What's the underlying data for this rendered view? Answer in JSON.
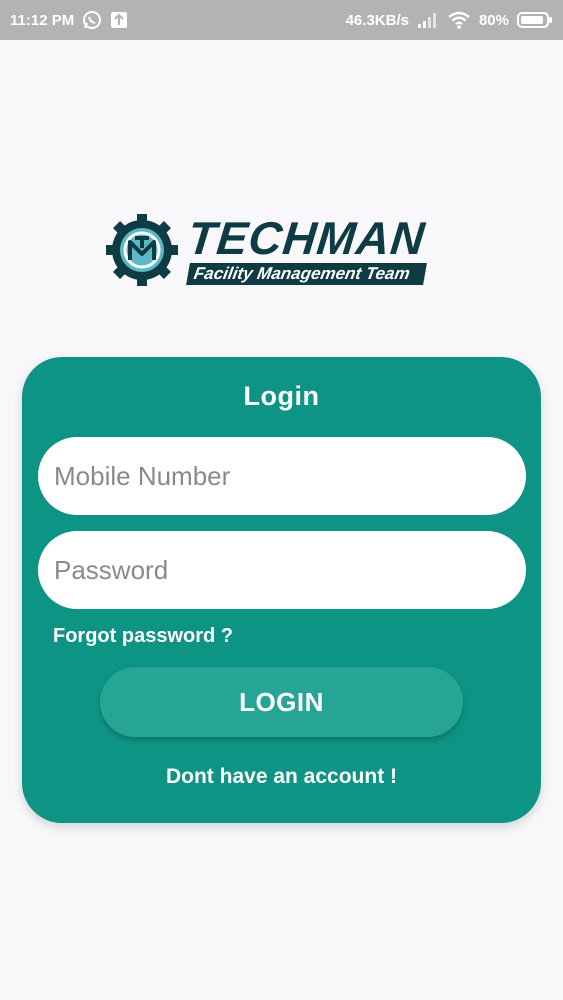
{
  "status_bar": {
    "time": "11:12 PM",
    "network_speed": "46.3KB/s",
    "battery": "80%",
    "icons": [
      "whatsapp-icon",
      "upload-icon",
      "signal-icon",
      "wifi-icon",
      "battery-icon"
    ]
  },
  "logo": {
    "brand": "TECHMAN",
    "tagline": "Facility Management Team",
    "mark_letter": "M"
  },
  "login": {
    "title": "Login",
    "mobile_placeholder": "Mobile Number",
    "mobile_value": "",
    "password_placeholder": "Password",
    "password_value": "",
    "forgot_label": "Forgot password ?",
    "button_label": "LOGIN",
    "signup_label": "Dont have an account !"
  },
  "colors": {
    "card": "#0e9484",
    "button": "#26a597",
    "brand": "#0f3b44",
    "status_bar": "#b3b3b3"
  }
}
